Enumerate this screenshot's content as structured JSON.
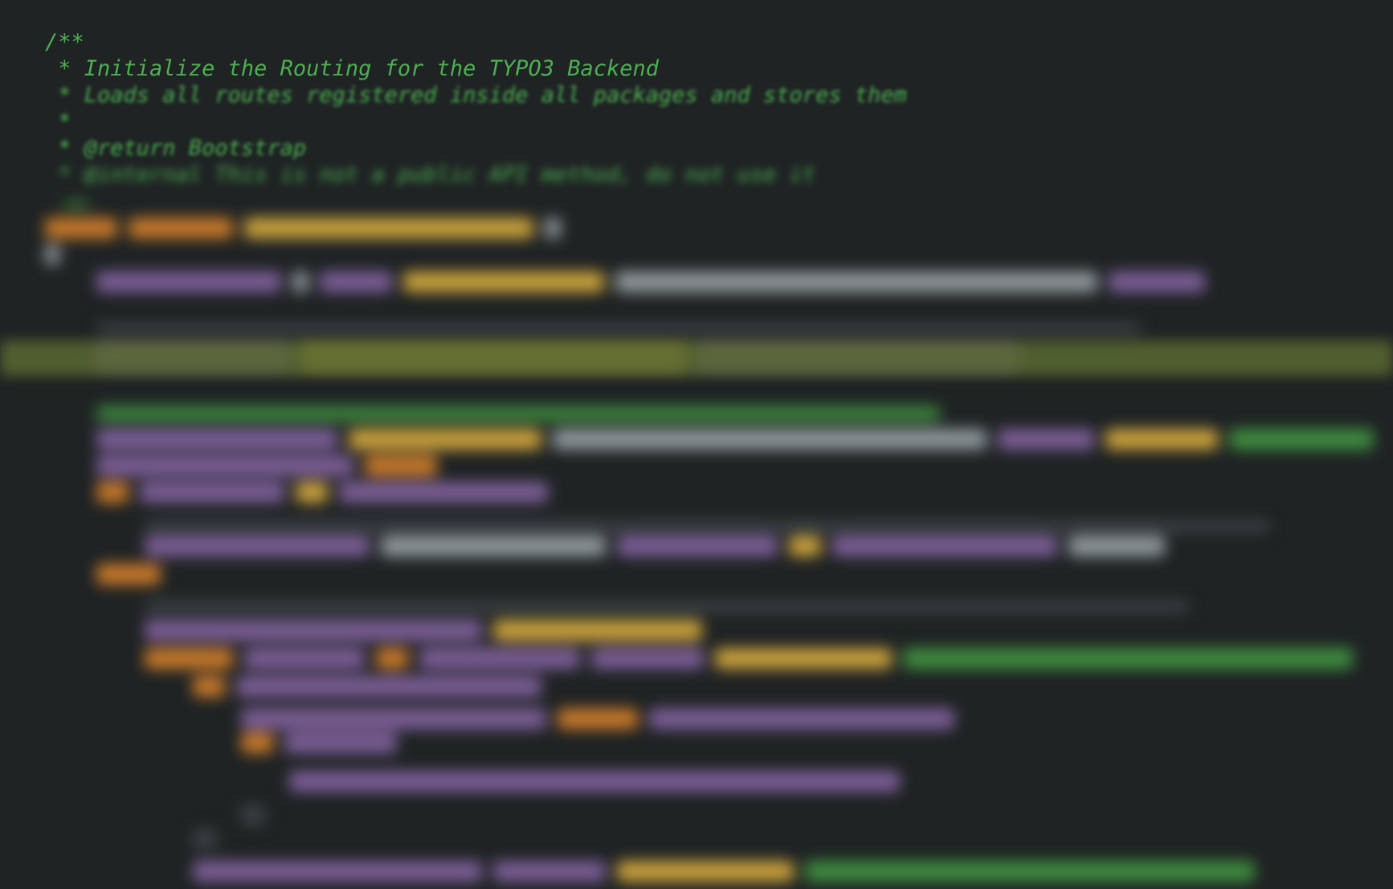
{
  "editor": {
    "docblock": [
      "/**",
      " * Initialize the Routing for the TYPO3 Backend",
      " * Loads all routes registered inside all packages and stores them",
      " *",
      " * @return Bootstrap",
      " * @internal This is not a public API method, do not use it"
    ]
  },
  "colors": {
    "background": "#1f2324",
    "comment": "#4caf50",
    "keyword": "#c7792a",
    "function": "#c9a13c",
    "variable": "#7b5e96",
    "string": "#8f979a",
    "line_highlight": "#5a6a32"
  }
}
